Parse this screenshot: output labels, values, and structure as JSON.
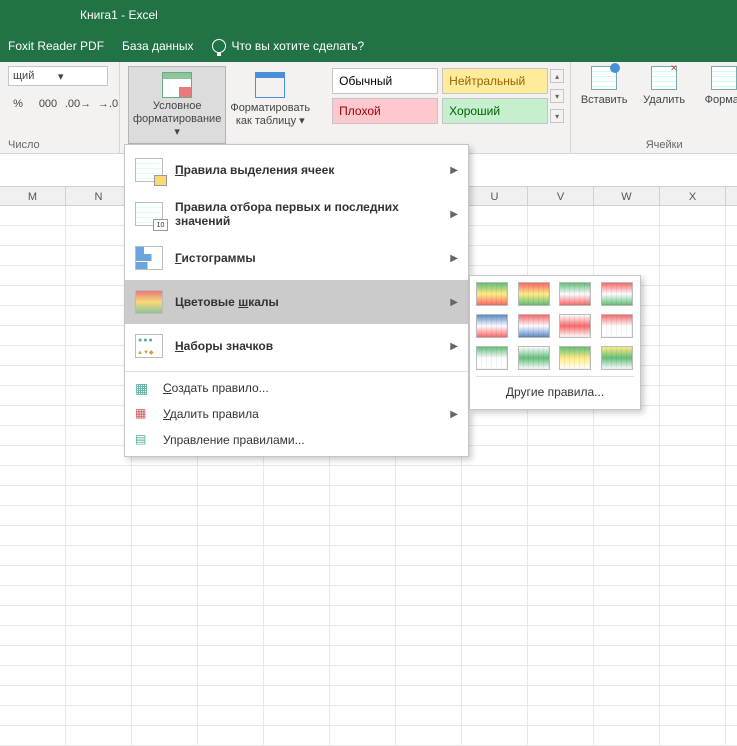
{
  "titlebar": {
    "title": "Книга1  -  Excel"
  },
  "tabs": {
    "foxit": "Foxit Reader PDF",
    "database": "База данных",
    "tellme": "Что вы хотите сделать?"
  },
  "ribbon": {
    "number": {
      "dropdown_suffix": "щий",
      "group_label": "Число"
    },
    "cond_fmt": {
      "label_l1": "Условное",
      "label_l2": "форматирование"
    },
    "fmt_table": {
      "label_l1": "Форматировать",
      "label_l2": "как таблицу"
    },
    "styles": {
      "normal": "Обычный",
      "neutral": "Нейтральный",
      "bad": "Плохой",
      "good": "Хороший"
    },
    "cells": {
      "insert": "Вставить",
      "delete": "Удалить",
      "format": "Формат",
      "group_label": "Ячейки"
    }
  },
  "cf_menu": {
    "highlight": "Правила выделения ячеек",
    "highlight_u": "П",
    "top": "равила отбора первых и последних значений",
    "top_pre": "П",
    "databars": "истограммы",
    "databars_pre": "Г",
    "colorscales_pre": "Цветовые ",
    "colorscales_u": "ш",
    "colorscales_post": "калы",
    "iconsets_pre": "",
    "iconsets_u": "Н",
    "iconsets_post": "аборы значков",
    "new_pre": "",
    "new_u": "С",
    "new_post": "оздать правило...",
    "clear_pre": "",
    "clear_u": "У",
    "clear_post": "далить правила",
    "manage": "Управление правилами..."
  },
  "cs_submenu": {
    "other": "Другие правила..."
  },
  "columns": [
    "M",
    "N",
    "",
    "",
    "",
    "",
    "",
    "U",
    "V",
    "W",
    "X"
  ],
  "colorscale_tiles": [
    [
      "#63be7b",
      "#ffeb84",
      "#f8696b"
    ],
    [
      "#f8696b",
      "#ffeb84",
      "#63be7b"
    ],
    [
      "#63be7b",
      "#fcfcff",
      "#f8696b"
    ],
    [
      "#f8696b",
      "#fcfcff",
      "#63be7b"
    ],
    [
      "#5a8ac6",
      "#fcfcff",
      "#f8696b"
    ],
    [
      "#f8696b",
      "#fcfcff",
      "#5a8ac6"
    ],
    [
      "#fcfcff",
      "#f8696b",
      "#ffffff"
    ],
    [
      "#f8696b",
      "#fcfcff",
      "#ffffff"
    ],
    [
      "#63be7b",
      "#fcfcff",
      "#ffffff"
    ],
    [
      "#fcfcff",
      "#63be7b",
      "#ffffff"
    ],
    [
      "#63be7b",
      "#ffeb84",
      "#ffffff"
    ],
    [
      "#ffeb84",
      "#63be7b",
      "#ffffff"
    ]
  ]
}
